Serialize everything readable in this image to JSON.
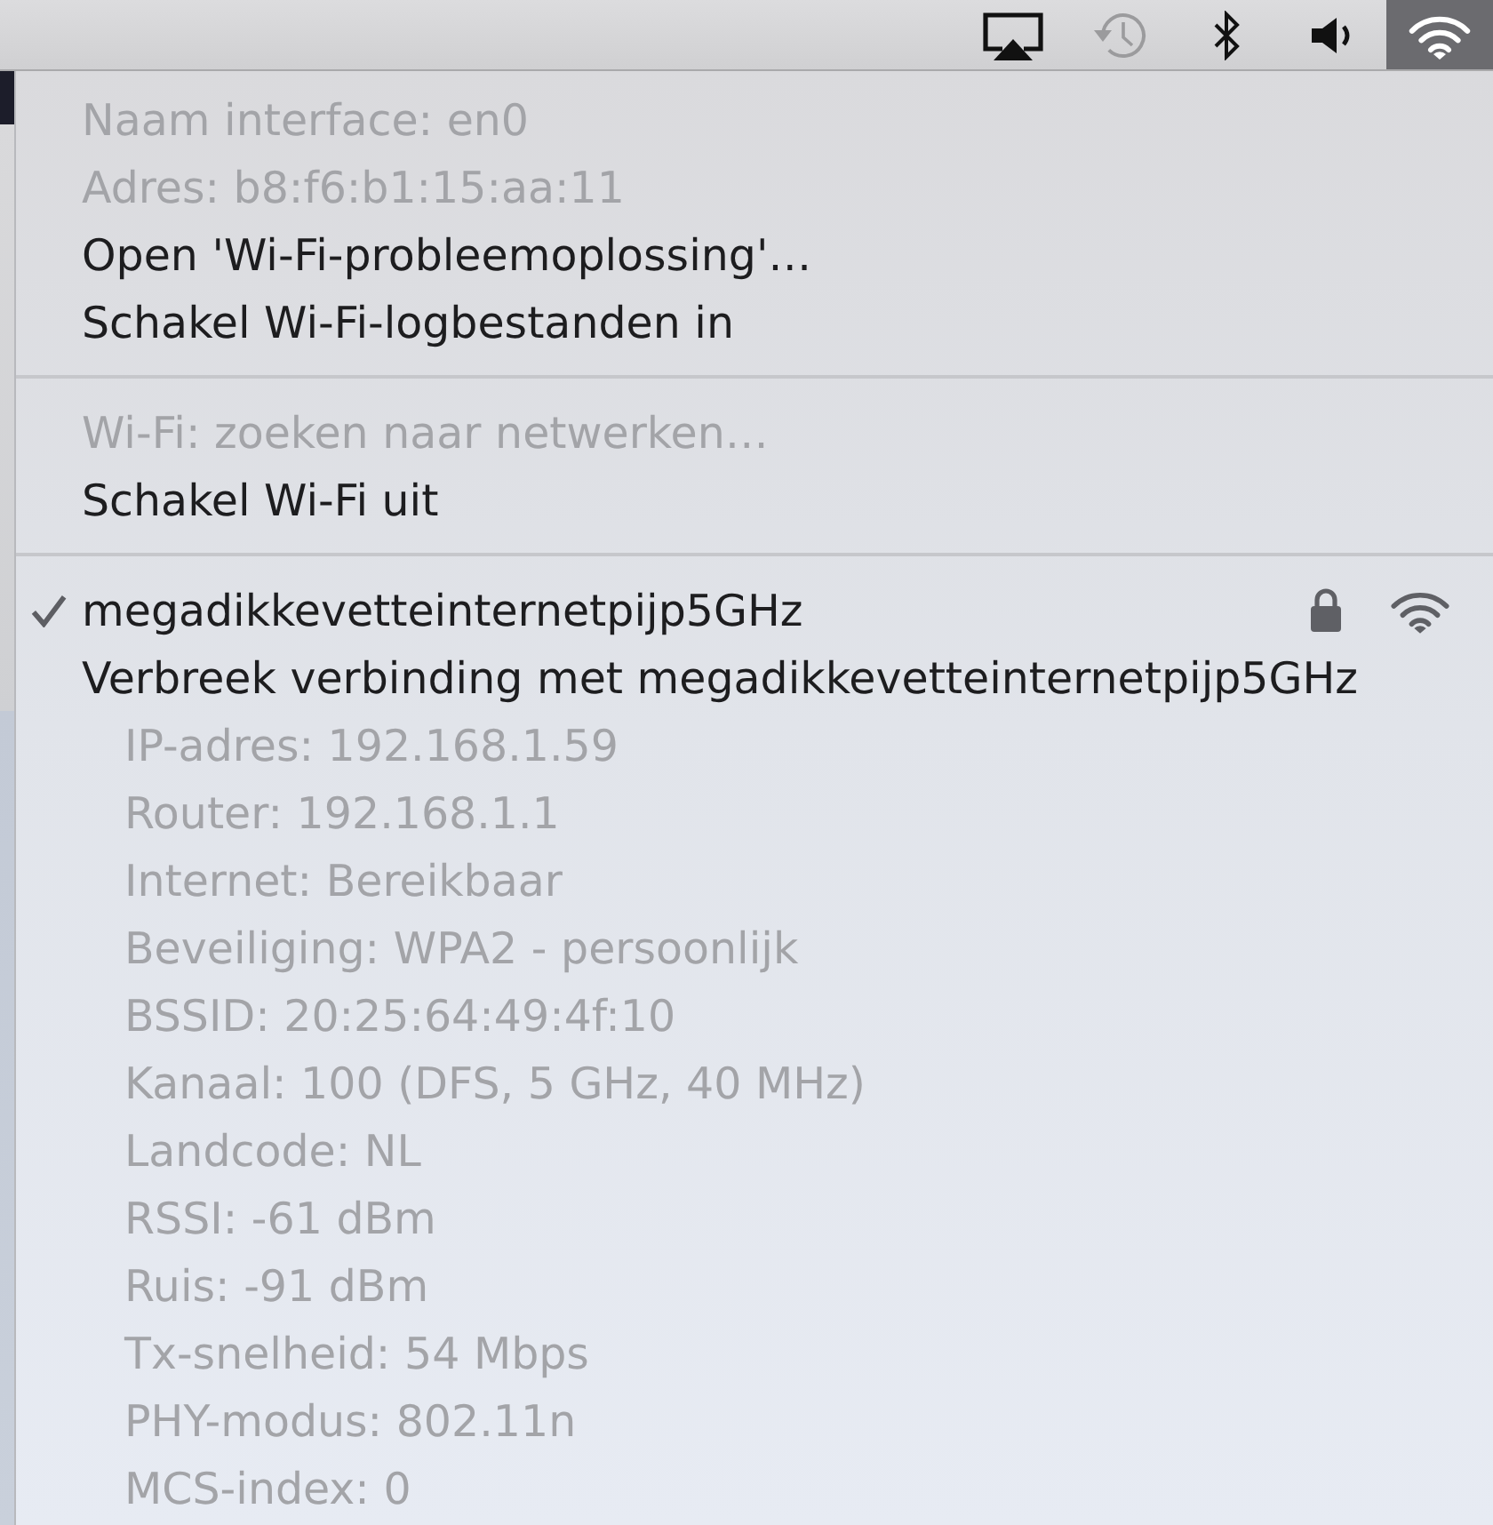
{
  "menu_bar": {
    "icons": [
      {
        "kind": "airplay",
        "selected": false,
        "disabled": false
      },
      {
        "kind": "time-machine",
        "selected": false,
        "disabled": true
      },
      {
        "kind": "bluetooth",
        "selected": false,
        "disabled": false
      },
      {
        "kind": "volume",
        "selected": false,
        "disabled": false
      },
      {
        "kind": "wifi",
        "selected": true,
        "disabled": false
      }
    ]
  },
  "menu": {
    "sections": [
      {
        "items": [
          {
            "kind": "item",
            "label": "Naam interface: en0",
            "disabled": true
          },
          {
            "kind": "item",
            "label": "Adres: b8:f6:b1:15:aa:11",
            "disabled": true
          },
          {
            "kind": "item",
            "label": "Open 'Wi-Fi-probleemoplossing'…",
            "disabled": false
          },
          {
            "kind": "item",
            "label": "Schakel Wi-Fi-logbestanden in",
            "disabled": false
          }
        ]
      },
      {
        "items": [
          {
            "kind": "item",
            "label": "Wi-Fi: zoeken naar netwerken…",
            "disabled": true
          },
          {
            "kind": "item",
            "label": "Schakel Wi-Fi uit",
            "disabled": false
          }
        ]
      },
      {
        "items": [
          {
            "kind": "network",
            "label": "megadikkevetteinternetpijp5GHz",
            "checked": true,
            "secured": true,
            "disabled": false
          },
          {
            "kind": "item",
            "label": "Verbreek verbinding met megadikkevetteinternetpijp5GHz",
            "disabled": false
          },
          {
            "kind": "detail",
            "label": "IP-adres: 192.168.1.59",
            "disabled": true
          },
          {
            "kind": "detail",
            "label": "Router: 192.168.1.1",
            "disabled": true
          },
          {
            "kind": "detail",
            "label": "Internet: Bereikbaar",
            "disabled": true
          },
          {
            "kind": "detail",
            "label": "Beveiliging: WPA2 - persoonlijk",
            "disabled": true
          },
          {
            "kind": "detail",
            "label": "BSSID: 20:25:64:49:4f:10",
            "disabled": true
          },
          {
            "kind": "detail",
            "label": "Kanaal: 100 (DFS, 5 GHz, 40 MHz)",
            "disabled": true
          },
          {
            "kind": "detail",
            "label": "Landcode: NL",
            "disabled": true
          },
          {
            "kind": "detail",
            "label": "RSSI: -61 dBm",
            "disabled": true
          },
          {
            "kind": "detail",
            "label": "Ruis: -91 dBm",
            "disabled": true
          },
          {
            "kind": "detail",
            "label": "Tx-snelheid: 54 Mbps",
            "disabled": true
          },
          {
            "kind": "detail",
            "label": "PHY-modus: 802.11n",
            "disabled": true
          },
          {
            "kind": "detail",
            "label": "MCS-index: 0",
            "disabled": true
          }
        ]
      }
    ]
  }
}
